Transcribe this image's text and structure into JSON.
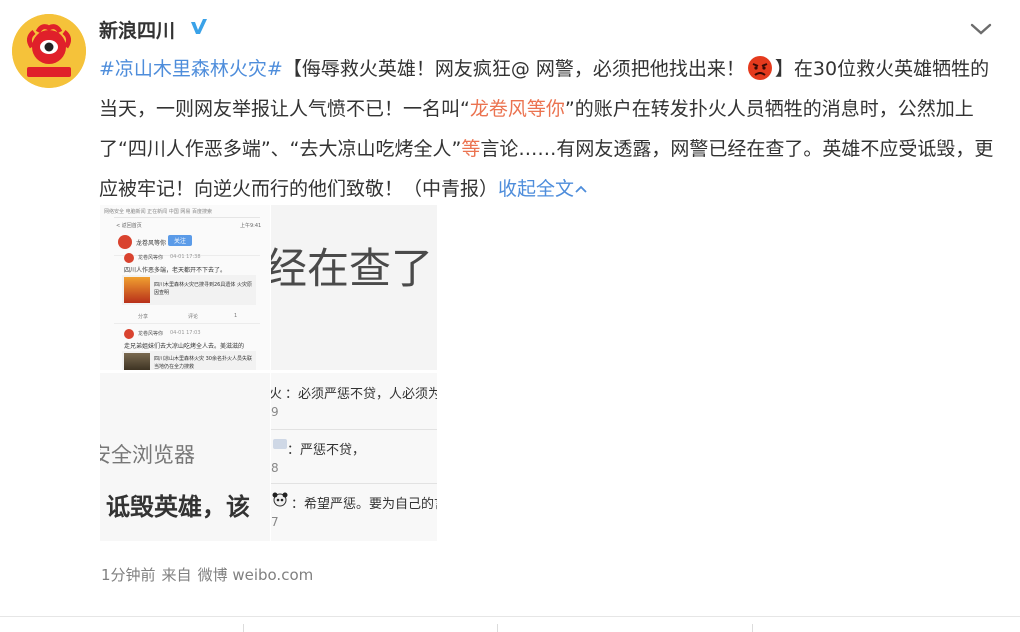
{
  "author": {
    "name": "新浪四川",
    "avatar_text": "sina 四川"
  },
  "post": {
    "topic": "#凉山木里森林火灾#",
    "segment1": "【侮辱救火英雄！网友疯狂@ 网警，必须把他找出来！",
    "segment2": "】在30位救火英雄牺牲的当天，一则网友举报让人气愤不已！一名叫“",
    "account": "龙卷风等你",
    "segment3": "”的账户在转发扑火人员牺牲的消息时，公然加上了“四川人作恶多端”、“去大凉山吃烤全人”",
    "deng": "等",
    "segment4": "言论……有网友透露，网警已经在查了。英雄不应受诋毁，更应被牢记！向逆火而行的他们致敬！（中青报）",
    "collapse_label": "收起全文"
  },
  "images": {
    "pic1": {
      "header_text": "网络安全 电脑新闻 正在新闻 中国 网易 百度搜索",
      "back_label": "< 返回首页",
      "time_label": "上午9:41",
      "profile_name": "龙卷风等你",
      "follow_label": "关注",
      "card1_name": "龙卷风等你",
      "card1_time": "04-01 17:38",
      "card1_text": "四川人作恶多端，老天都开不下去了。",
      "card1_link": "四川木里森林火灾已搜寻到26具遗体 火灾原因查明",
      "actions": [
        "分享",
        "评论",
        "1"
      ],
      "card2_name": "龙卷风等你",
      "card2_time": "04-01 17:03",
      "card2_text": "走兄弟姐妹们去大凉山吃烤全人去。美滋滋的",
      "card2_link": "四川凉山木里森林火灾 30余名扑火人员失联 当地仍在全力搜救"
    },
    "pic2": {
      "text": "经在查了，"
    },
    "pic3": {
      "line1": "安全浏览器",
      "line2": "诋毁英雄，该"
    },
    "pic4": {
      "comments": [
        {
          "name": "火",
          "text": "：必须严惩不贷，人必须为自",
          "num": "9"
        },
        {
          "name": "",
          "text": "：严惩不贷，",
          "num": "8"
        },
        {
          "name": "",
          "text": "：希望严惩。要为自己的言",
          "num": "7"
        }
      ]
    }
  },
  "footer": {
    "time": "1分钟前",
    "from_label": "来自",
    "source": "微博 weibo.com"
  },
  "colors": {
    "link_orange": "#eb7350",
    "link_blue": "#4e8ddb",
    "verified": "#3aa2e8"
  }
}
